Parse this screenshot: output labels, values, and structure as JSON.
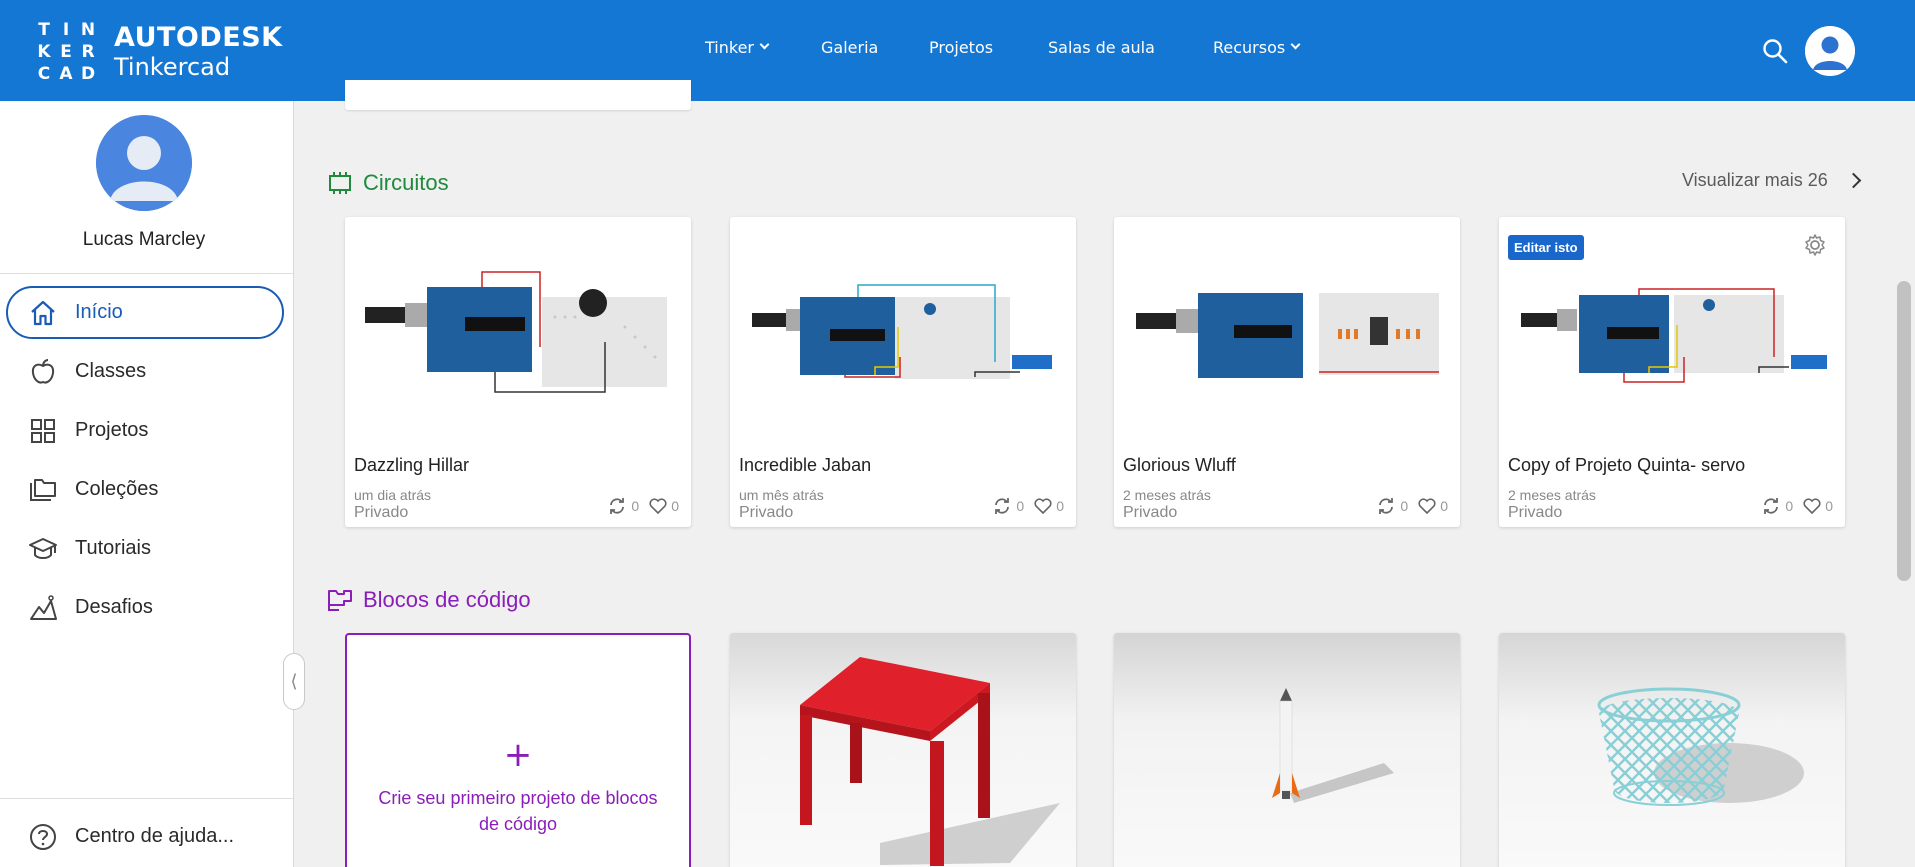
{
  "header": {
    "logo_letters": [
      "T",
      "I",
      "N",
      "K",
      "E",
      "R",
      "C",
      "A",
      "D"
    ],
    "brand_line1": "AUTODESK",
    "brand_line2": "Tinkercad",
    "nav": [
      {
        "label": "Tinker",
        "dropdown": true
      },
      {
        "label": "Galeria",
        "dropdown": false
      },
      {
        "label": "Projetos",
        "dropdown": false
      },
      {
        "label": "Salas de aula",
        "dropdown": false
      },
      {
        "label": "Recursos",
        "dropdown": true
      }
    ],
    "icons": {
      "search": "search-icon",
      "avatar": "user-avatar-icon"
    },
    "background_color": "#1477d4"
  },
  "sidebar": {
    "user_name": "Lucas Marcley",
    "items": [
      {
        "label": "Início",
        "icon": "home-icon",
        "active": true
      },
      {
        "label": "Classes",
        "icon": "apple-icon",
        "active": false
      },
      {
        "label": "Projetos",
        "icon": "grid-icon",
        "active": false
      },
      {
        "label": "Coleções",
        "icon": "folders-icon",
        "active": false
      },
      {
        "label": "Tutoriais",
        "icon": "graduation-cap-icon",
        "active": false
      },
      {
        "label": "Desafios",
        "icon": "chart-mountain-icon",
        "active": false
      }
    ],
    "help_label": "Centro de ajuda...",
    "collapse_glyph": "⟨"
  },
  "circuits": {
    "title": "Circuitos",
    "color": "#1e8a3c",
    "view_more": "Visualizar mais 26",
    "cards": [
      {
        "title": "Dazzling Hillar",
        "date": "um dia atrás",
        "privacy": "Privado",
        "remixes": "0",
        "likes": "0"
      },
      {
        "title": "Incredible Jaban",
        "date": "um mês atrás",
        "privacy": "Privado",
        "remixes": "0",
        "likes": "0"
      },
      {
        "title": "Glorious Wluff",
        "date": "2 meses atrás",
        "privacy": "Privado",
        "remixes": "0",
        "likes": "0"
      },
      {
        "title": "Copy of Projeto Quinta- servo",
        "date": "2 meses atrás",
        "privacy": "Privado",
        "remixes": "0",
        "likes": "0",
        "badge": "Editar isto"
      }
    ]
  },
  "codeblocks": {
    "title": "Blocos de código",
    "color": "#8b1db8",
    "create_plus": "+",
    "create_text": "Crie seu primeiro projeto de blocos de código"
  }
}
